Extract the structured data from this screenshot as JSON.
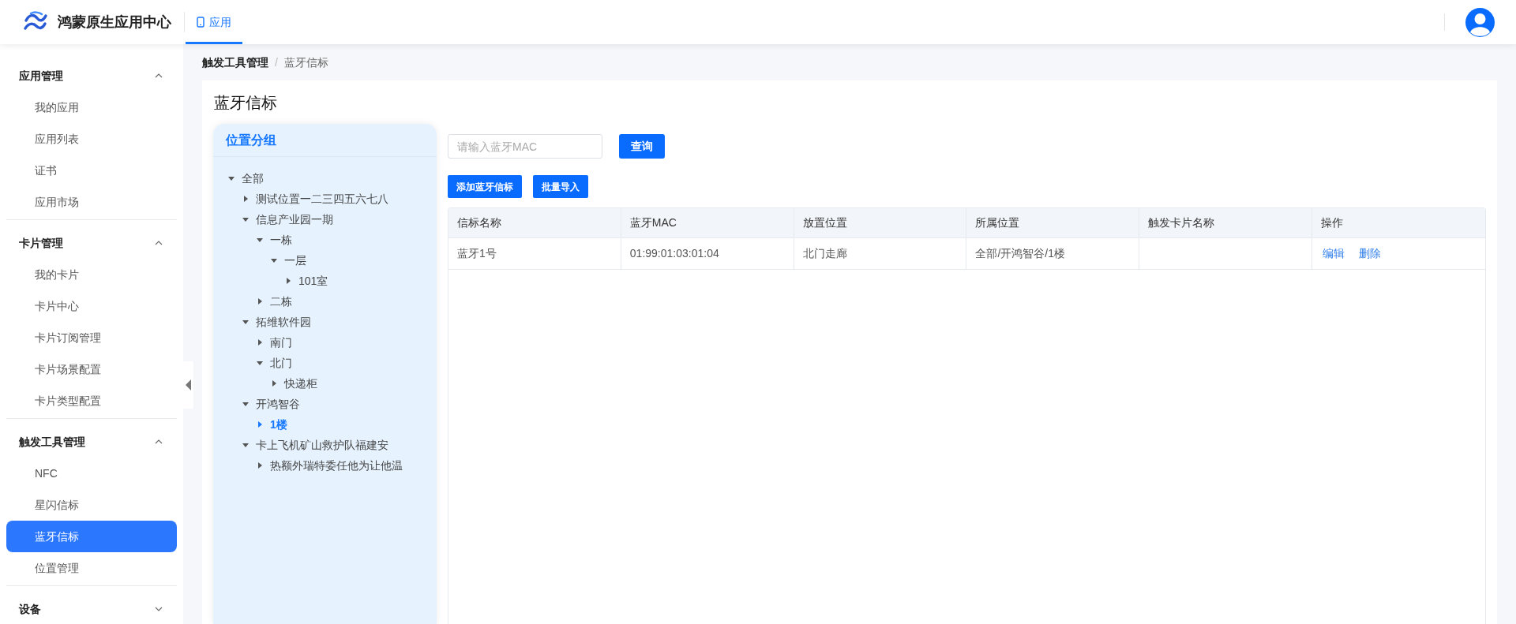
{
  "header": {
    "app_name": "鸿蒙原生应用中心",
    "nav_tabs": [
      {
        "label": "应用",
        "selected": true
      }
    ]
  },
  "sidebar": {
    "groups": [
      {
        "title": "应用管理",
        "expanded": true,
        "items": [
          {
            "label": "我的应用",
            "selected": false
          },
          {
            "label": "应用列表",
            "selected": false
          },
          {
            "label": "证书",
            "selected": false
          },
          {
            "label": "应用市场",
            "selected": false
          }
        ]
      },
      {
        "title": "卡片管理",
        "expanded": true,
        "items": [
          {
            "label": "我的卡片",
            "selected": false
          },
          {
            "label": "卡片中心",
            "selected": false
          },
          {
            "label": "卡片订阅管理",
            "selected": false
          },
          {
            "label": "卡片场景配置",
            "selected": false
          },
          {
            "label": "卡片类型配置",
            "selected": false
          }
        ]
      },
      {
        "title": "触发工具管理",
        "expanded": true,
        "items": [
          {
            "label": "NFC",
            "selected": false
          },
          {
            "label": "星闪信标",
            "selected": false
          },
          {
            "label": "蓝牙信标",
            "selected": true
          },
          {
            "label": "位置管理",
            "selected": false
          }
        ]
      },
      {
        "title": "设备",
        "expanded": false
      }
    ]
  },
  "breadcrumb": [
    "触发工具管理",
    "蓝牙信标"
  ],
  "breadcrumb_separator": "/",
  "page_title": "蓝牙信标",
  "tree": {
    "title": "位置分组",
    "nodes": [
      {
        "label": "全部",
        "expanded": true,
        "selected": false,
        "children": [
          {
            "label": "测试位置一二三四五六七八",
            "expanded": false,
            "selected": false
          },
          {
            "label": "信息产业园一期",
            "expanded": true,
            "selected": false,
            "children": [
              {
                "label": "一栋",
                "expanded": true,
                "selected": false,
                "children": [
                  {
                    "label": "一层",
                    "expanded": true,
                    "selected": false,
                    "children": [
                      {
                        "label": "101室",
                        "expanded": false,
                        "selected": false
                      }
                    ]
                  }
                ]
              },
              {
                "label": "二栋",
                "expanded": false,
                "selected": false
              }
            ]
          },
          {
            "label": "拓维软件园",
            "expanded": true,
            "selected": false,
            "children": [
              {
                "label": "南门",
                "expanded": false,
                "selected": false
              },
              {
                "label": "北门",
                "expanded": true,
                "selected": false,
                "children": [
                  {
                    "label": "快递柜",
                    "expanded": false,
                    "selected": false
                  }
                ]
              }
            ]
          },
          {
            "label": "开鸿智谷",
            "expanded": true,
            "selected": false,
            "children": [
              {
                "label": "1楼",
                "expanded": false,
                "selected": true
              }
            ]
          },
          {
            "label": "卡上飞机矿山救护队福建安",
            "expanded": true,
            "selected": false,
            "children": [
              {
                "label": "热额外瑞特委任他为让他温",
                "expanded": false,
                "selected": false
              }
            ]
          }
        ]
      }
    ]
  },
  "search": {
    "placeholder": "请输入蓝牙MAC",
    "button": "查询"
  },
  "toolbar_buttons": [
    "添加蓝牙信标",
    "批量导入"
  ],
  "table": {
    "columns": [
      "信标名称",
      "蓝牙MAC",
      "放置位置",
      "所属位置",
      "触发卡片名称",
      "操作"
    ],
    "rows": [
      {
        "cells": [
          "蓝牙1号",
          "01:99:01:03:01:04",
          "北门走廊",
          "全部/开鸿智谷/1楼",
          ""
        ],
        "actions": [
          "编辑",
          "删除"
        ]
      }
    ]
  }
}
